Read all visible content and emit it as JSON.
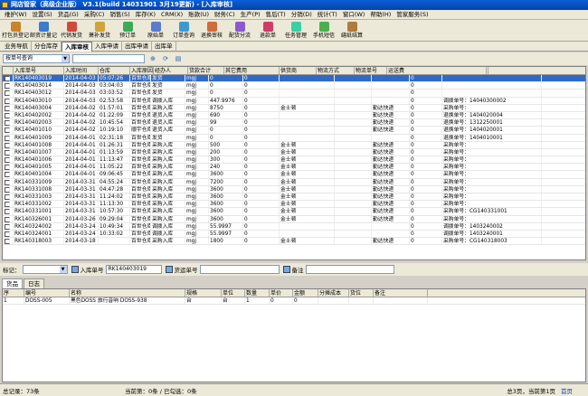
{
  "title": "网店管家（高级企业版） V3.1(build 14031901 3月19更新) - [入库审核]",
  "menu": [
    "维护(W)",
    "设置(S)",
    "货品(G)",
    "采购(C)",
    "销售(S)",
    "库存(K)",
    "CRM(X)",
    "账款(U)",
    "财务(C)",
    "生产(P)",
    "售后(T)",
    "分销(D)",
    "统计(T)",
    "窗口(W)",
    "帮助(H)",
    "管家服务(S)"
  ],
  "toolbar": [
    {
      "label": "打包员登记",
      "icon": "pack-icon",
      "color": "#c9832b"
    },
    {
      "label": "邮资计量记",
      "icon": "scale-icon",
      "color": "#3b7bd0"
    },
    {
      "label": "代销发货",
      "icon": "truck-icon",
      "color": "#d04a3b"
    },
    {
      "label": "萧补发货",
      "icon": "box-icon",
      "color": "#d0a43b"
    },
    {
      "label": "预订单",
      "icon": "order-icon",
      "color": "#3bab5a"
    },
    {
      "label": "原始单",
      "icon": "doc-icon",
      "color": "#5a7bd0"
    },
    {
      "label": "订单查询",
      "icon": "search-icon",
      "color": "#3b9bd0"
    },
    {
      "label": "退换审核",
      "icon": "return-icon",
      "color": "#d06b3b"
    },
    {
      "label": "配货分流",
      "icon": "split-icon",
      "color": "#8b5bd0"
    },
    {
      "label": "退款单",
      "icon": "refund-icon",
      "color": "#d03b6b"
    },
    {
      "label": "任务管理",
      "icon": "task-icon",
      "color": "#3bd0a4"
    },
    {
      "label": "手机短信",
      "icon": "sms-icon",
      "color": "#4bb04b"
    },
    {
      "label": "缝纸结算",
      "icon": "calc-icon",
      "color": "#b07b3b"
    }
  ],
  "tabs": [
    "业务导航",
    "分仓库存",
    "入库审核",
    "入库申请",
    "出库申请",
    "出库单"
  ],
  "active_tab": 2,
  "filter": {
    "combo": "按单号查询"
  },
  "grid_headers": [
    "入库单号",
    "入库时间",
    "仓库",
    "入库原因",
    "经办人",
    "货款合计",
    "其它费用",
    "供货商",
    "物流方式",
    "物流单号",
    "运送费",
    "备注"
  ],
  "rows": [
    [
      "RK140403019",
      "2014-04-03",
      "05:07:26",
      "百世仓库",
      "发货",
      "mgj",
      "0",
      "0",
      "",
      "",
      "",
      "0",
      ""
    ],
    [
      "RK140403014",
      "2014-04-03",
      "03:04:03",
      "百世仓库",
      "发货",
      "mgj",
      "0",
      "0",
      "",
      "",
      "",
      "0",
      ""
    ],
    [
      "RK140403012",
      "2014-04-03",
      "03:03:52",
      "百世仓库",
      "发货",
      "mgj",
      "0",
      "0",
      "",
      "",
      "",
      "0",
      ""
    ],
    [
      "RK140403010",
      "2014-04-03",
      "02:53:58",
      "百世仓库",
      "调拨入库",
      "mgj",
      "447.9976",
      "0",
      "",
      "",
      "",
      "0",
      "调拨单号：14040300002"
    ],
    [
      "RK140403004",
      "2014-04-02",
      "01:57:01",
      "百世仓库",
      "采购入库",
      "mgj",
      "8750",
      "0",
      "金士顿",
      "",
      "勤达快递",
      "0",
      "采购单号："
    ],
    [
      "RK140402002",
      "2014-04-02",
      "01:22:09",
      "百世仓库",
      "退货入库",
      "mgj",
      "690",
      "0",
      "",
      "",
      "勤达快递",
      "0",
      "退换单号：1404020004"
    ],
    [
      "RK140402003",
      "2014-04-02",
      "10:45:54",
      "百世仓库",
      "退货入库",
      "mgj",
      "99",
      "0",
      "",
      "",
      "勤达快递",
      "0",
      "退换单号：1312250001"
    ],
    [
      "RK140401010",
      "2014-04-02",
      "10:19:10",
      "顺宇仓库",
      "退货入库",
      "mgj",
      "0",
      "0",
      "",
      "",
      "勤达快递",
      "0",
      "退换单号：1404020001"
    ],
    [
      "RK140401009",
      "2014-04-01",
      "02:31:18",
      "百世仓库",
      "发货",
      "mgj",
      "0",
      "0",
      "",
      "",
      "",
      "0",
      "退换单号：1404010001"
    ],
    [
      "RK140401008",
      "2014-04-01",
      "01:26:31",
      "百世仓库",
      "采购入库",
      "mgj",
      "500",
      "0",
      "金士顿",
      "",
      "勤达快递",
      "0",
      "采购单号："
    ],
    [
      "RK140401007",
      "2014-04-01",
      "01:13:59",
      "百世仓库",
      "采购入库",
      "mgj",
      "200",
      "0",
      "金士顿",
      "",
      "勤达快递",
      "0",
      "采购单号："
    ],
    [
      "RK140401006",
      "2014-04-01",
      "11:13:47",
      "百世仓库",
      "采购入库",
      "mgj",
      "300",
      "0",
      "金士顿",
      "",
      "勤达快递",
      "0",
      "采购单号："
    ],
    [
      "RK140401005",
      "2014-04-01",
      "11:05:22",
      "百世仓库",
      "采购入库",
      "mgj",
      "240",
      "0",
      "金士顿",
      "",
      "勤达快递",
      "0",
      "采购单号："
    ],
    [
      "RK140401004",
      "2014-04-01",
      "09:06:45",
      "百世仓库",
      "采购入库",
      "mgj",
      "3600",
      "0",
      "金士顿",
      "",
      "勤达快递",
      "0",
      "采购单号："
    ],
    [
      "RK140331009",
      "2014-03-31",
      "04:55:24",
      "百世仓库",
      "采购入库",
      "mgj",
      "7200",
      "0",
      "金士顿",
      "",
      "勤达快递",
      "0",
      "采购单号："
    ],
    [
      "RK140331008",
      "2014-03-31",
      "04:47:28",
      "百世仓库",
      "采购入库",
      "mgj",
      "3600",
      "0",
      "金士顿",
      "",
      "勤达快递",
      "0",
      "采购单号："
    ],
    [
      "RK140331003",
      "2014-03-31",
      "11:24:02",
      "百世仓库",
      "采购入库",
      "mgj",
      "3600",
      "0",
      "金士顿",
      "",
      "勤达快递",
      "0",
      "采购单号："
    ],
    [
      "RK140331002",
      "2014-03-31",
      "11:13:30",
      "百世仓库",
      "采购入库",
      "mgj",
      "3600",
      "0",
      "金士顿",
      "",
      "勤达快递",
      "0",
      "采购单号："
    ],
    [
      "RK140331001",
      "2014-03-31",
      "10:57:30",
      "百世仓库",
      "采购入库",
      "mgj",
      "3600",
      "0",
      "金士顿",
      "",
      "勤达快递",
      "0",
      "采购单号：CG140331001"
    ],
    [
      "RK140326001",
      "2014-03-26",
      "09:29:04",
      "百世仓库",
      "采购入库",
      "mgj",
      "3600",
      "0",
      "金士顿",
      "",
      "勤达快递",
      "0",
      "采购单号："
    ],
    [
      "RK140324002",
      "2014-03-24",
      "10:49:34",
      "百世仓库",
      "调拨入库",
      "mgj",
      "55.9997",
      "0",
      "",
      "",
      "",
      "0",
      "调拨单号：1403240002"
    ],
    [
      "RK140324001",
      "2014-03-24",
      "10:33:02",
      "百世仓库",
      "调拨入库",
      "mgj",
      "55.9997",
      "0",
      "",
      "",
      "",
      "0",
      "调拨单号：1403240001"
    ],
    [
      "RK140318003",
      "2014-03-18",
      "",
      "百世仓库",
      "采购入库",
      "mgj",
      "1800",
      "0",
      "金士顿",
      "",
      "勤达快递",
      "0",
      "采购单号：CG140318003"
    ]
  ],
  "detail": {
    "mark_label": "标记：",
    "inbound_no_label": "入库单号",
    "inbound_no": "RK140403019",
    "waybill_label": "货运单号",
    "remark_label": "备注"
  },
  "bottom_tabs": [
    "货品",
    "日志"
  ],
  "bottom_headers": [
    "序",
    "编号",
    "名称",
    "规格",
    "单位",
    "数量",
    "单价",
    "金额",
    "分摊成本",
    "货位",
    "备注"
  ],
  "bottom_rows": [
    [
      "1",
      "DOSS-005",
      "黑色DOSS 旅行音响 DOSS-938",
      "台",
      "台",
      "1",
      "0",
      "0",
      "",
      "",
      ""
    ]
  ],
  "status": {
    "total": "总记录：73条",
    "current": "当前第：0条 / 已勾选：0条",
    "pages": "总3页，当前第1页",
    "first": "首页"
  }
}
